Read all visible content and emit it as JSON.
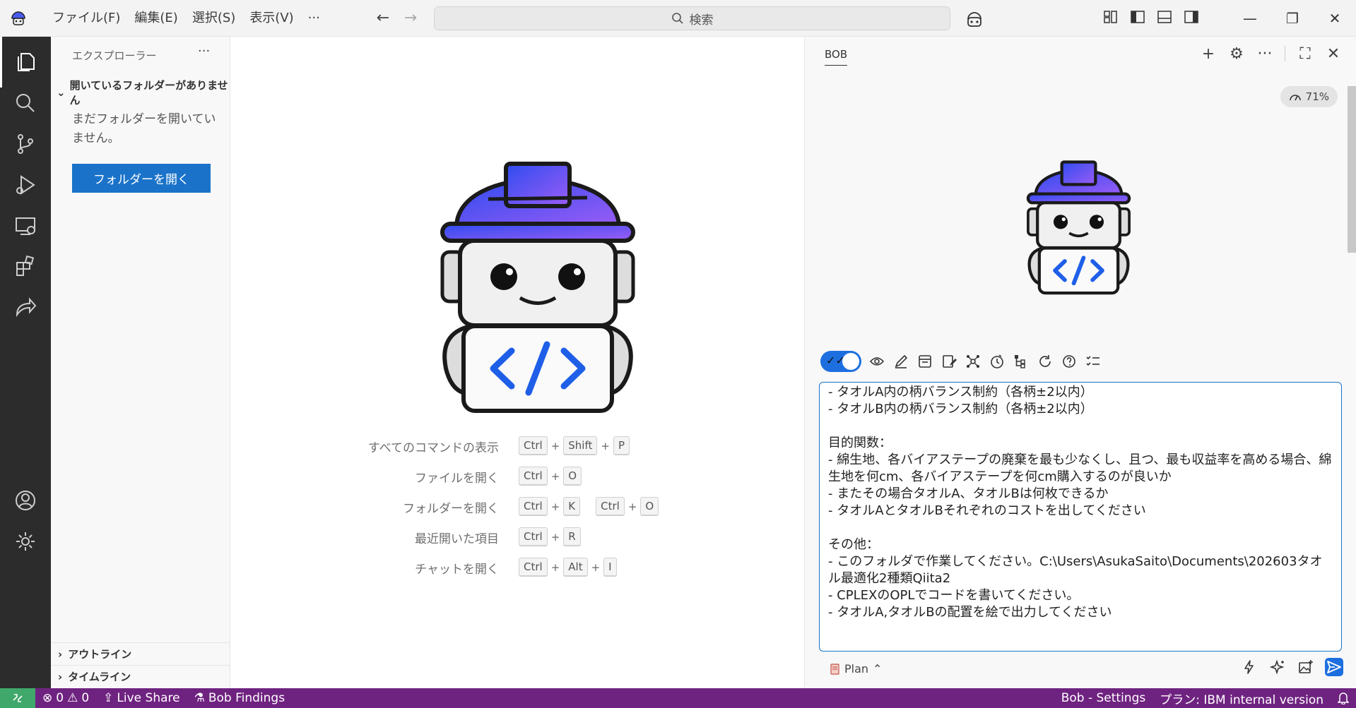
{
  "menubar": {
    "items": [
      "ファイル(F)",
      "編集(E)",
      "選択(S)",
      "表示(V)",
      "···"
    ]
  },
  "titlebar": {
    "search_placeholder": "検索"
  },
  "sidebar": {
    "title": "エクスプローラー",
    "more": "···",
    "section_title": "開いているフォルダーがありません",
    "message": "まだフォルダーを開いていません。",
    "open_folder_button": "フォルダーを開く",
    "outline": "アウトライン",
    "timeline": "タイムライン"
  },
  "shortcuts": [
    {
      "label": "すべてのコマンドの表示",
      "keys": [
        [
          "Ctrl",
          "Shift",
          "P"
        ]
      ]
    },
    {
      "label": "ファイルを開く",
      "keys": [
        [
          "Ctrl",
          "O"
        ]
      ]
    },
    {
      "label": "フォルダーを開く",
      "keys": [
        [
          "Ctrl",
          "K"
        ],
        [
          "Ctrl",
          "O"
        ]
      ]
    },
    {
      "label": "最近開いた項目",
      "keys": [
        [
          "Ctrl",
          "R"
        ]
      ]
    },
    {
      "label": "チャットを開く",
      "keys": [
        [
          "Ctrl",
          "Alt",
          "I"
        ]
      ]
    }
  ],
  "chat": {
    "tab_label": "BOB",
    "context_percent": "71%",
    "input_lines": [
      "- タオルA内の柄バランス制約（各柄±2以内）",
      "- タオルB内の柄バランス制約（各柄±2以内）",
      "",
      "目的関数：",
      "- 綿生地、各バイアステープの廃棄を最も少なくし、且つ、最も収益率を高める場合、綿生地を何cm、各バイアステープを何cm購入するのが良いか",
      "- またその場合タオルA、タオルBは何枚できるか",
      "- タオルAとタオルBそれぞれのコストを出してください",
      "",
      "その他：",
      "- このフォルダで作業してください。C:\\Users\\AsukaSaito\\Documents\\202603タオル最適化2種類Qiita2",
      "- CPLEXのOPLでコードを書いてください。",
      "- タオルA,タオルBの配置を絵で出力してください"
    ],
    "mode_label": "Plan"
  },
  "statusbar": {
    "errors": "0",
    "warnings": "0",
    "live_share": "Live Share",
    "bob_findings": "Bob Findings",
    "bob_settings": "Bob - Settings",
    "plan": "プラン: IBM internal version"
  },
  "colors": {
    "accent": "#1a73c9",
    "statusbar": "#6f2380",
    "activitybar": "#2c2c2c",
    "remote": "#3fa86a"
  }
}
